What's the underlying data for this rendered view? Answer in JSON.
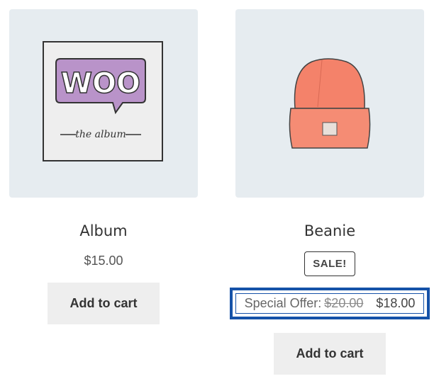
{
  "products": [
    {
      "name": "Album",
      "price": "$15.00",
      "button_label": "Add to cart",
      "image_text": {
        "logo": "WOO",
        "caption": "the album"
      }
    },
    {
      "name": "Beanie",
      "badge": "SALE!",
      "offer_label": "Special Offer:",
      "regular_price": "$20.00",
      "sale_price": "$18.00",
      "button_label": "Add to cart"
    }
  ],
  "colors": {
    "thumb_bg": "#e6ecf0",
    "highlight_border": "#1552a8",
    "beanie": "#f4826a",
    "woo_purple": "#b993c9"
  }
}
